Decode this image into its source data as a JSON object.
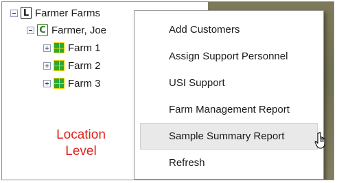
{
  "tree": {
    "root": {
      "label": "Farmer Farms",
      "icon": "location-icon",
      "letter": "L"
    },
    "customer": {
      "label": "Farmer, Joe",
      "icon": "customer-icon",
      "letter": "C"
    },
    "farms": [
      {
        "label": "Farm 1",
        "icon": "farm-icon"
      },
      {
        "label": "Farm 2",
        "icon": "farm-icon"
      },
      {
        "label": "Farm 3",
        "icon": "farm-icon"
      }
    ]
  },
  "annotation": {
    "line1": "Location",
    "line2": "Level",
    "color": "#e0201a"
  },
  "context_menu": {
    "items": [
      {
        "label": "Add Customers"
      },
      {
        "label": "Assign Support Personnel"
      },
      {
        "label": "USI Support"
      },
      {
        "label": "Farm Management Report"
      },
      {
        "label": "Sample Summary Report",
        "hovered": true
      },
      {
        "label": "Refresh"
      }
    ]
  },
  "cursor": "hand-pointer-icon"
}
